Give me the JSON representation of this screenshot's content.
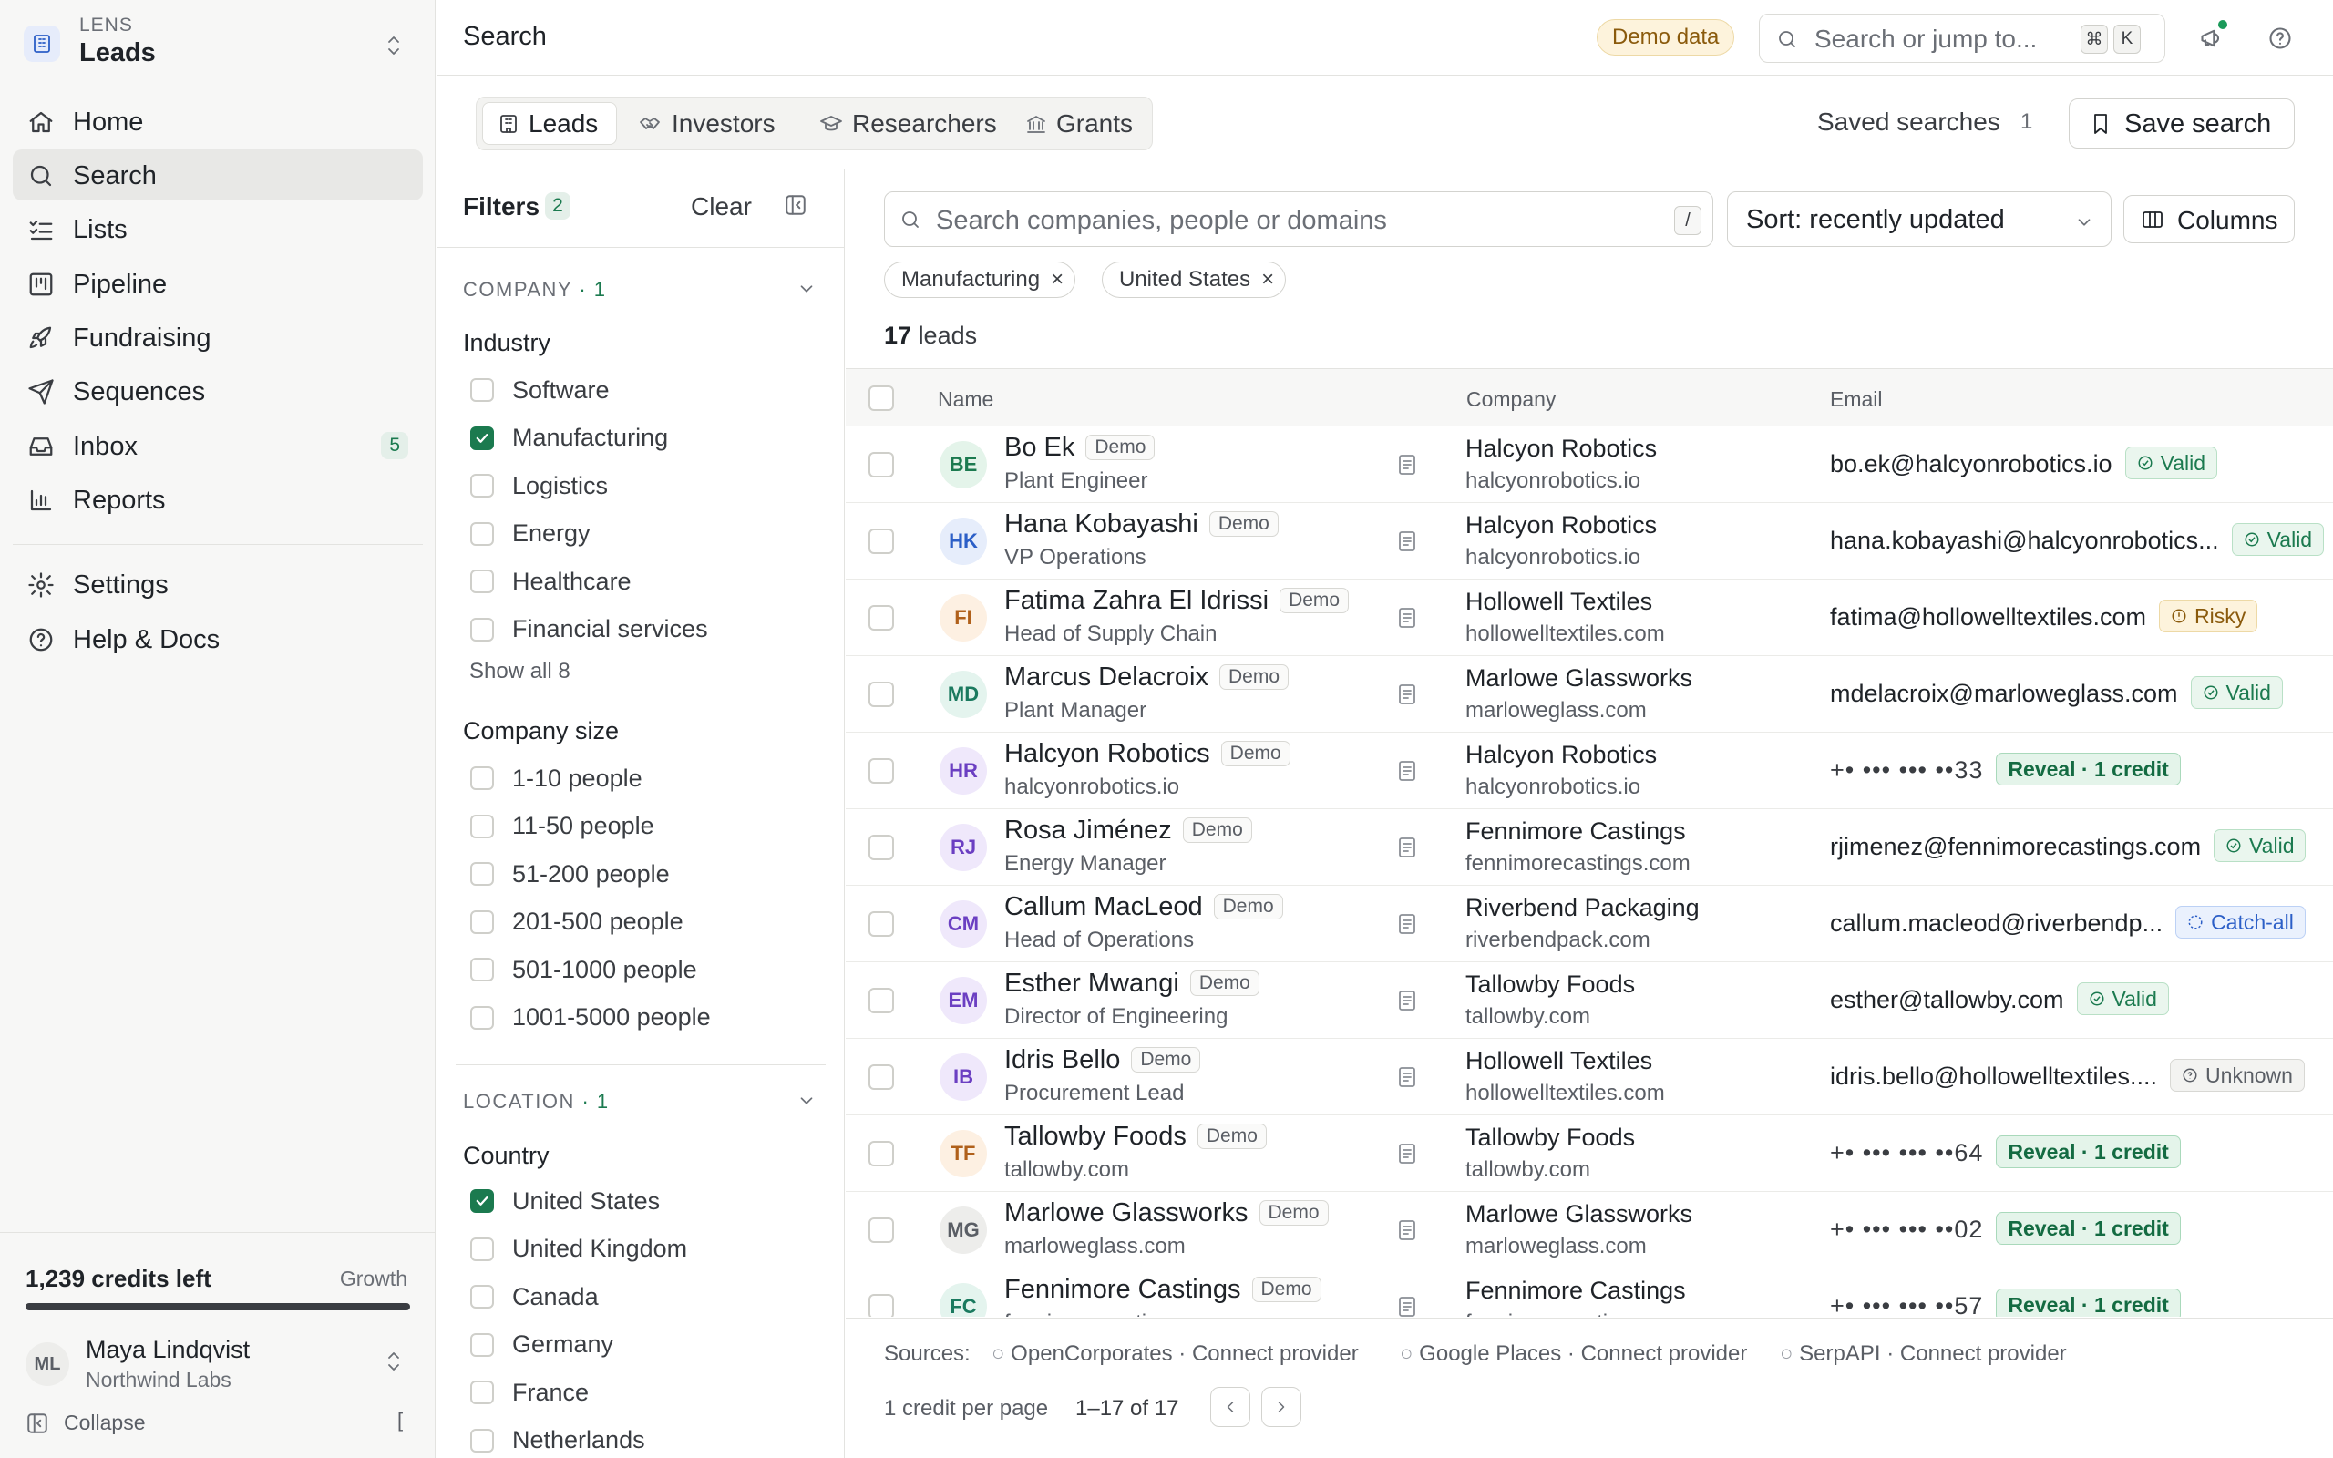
{
  "workspace": {
    "small_label": "LENS",
    "name": "Leads"
  },
  "nav": [
    {
      "label": "Home",
      "icon": "home-icon"
    },
    {
      "label": "Search",
      "icon": "search-icon",
      "active": true
    },
    {
      "label": "Lists",
      "icon": "list-check-icon"
    },
    {
      "label": "Pipeline",
      "icon": "kanban-icon"
    },
    {
      "label": "Fundraising",
      "icon": "rocket-icon"
    },
    {
      "label": "Sequences",
      "icon": "send-icon"
    },
    {
      "label": "Inbox",
      "icon": "inbox-icon",
      "count": "5"
    },
    {
      "label": "Reports",
      "icon": "bar-chart-icon"
    }
  ],
  "nav_secondary": [
    {
      "label": "Settings",
      "icon": "gear-icon"
    },
    {
      "label": "Help & Docs",
      "icon": "help-icon"
    }
  ],
  "credits": {
    "text": "1,239 credits left",
    "plan": "Growth",
    "fraction": 1.0
  },
  "user": {
    "initials": "ML",
    "name": "Maya Lindqvist",
    "org": "Northwind Labs"
  },
  "collapse": {
    "label": "Collapse",
    "shortcut": "["
  },
  "topbar": {
    "title": "Search",
    "demo_badge": "Demo data",
    "search_placeholder": "Search or jump to...",
    "kbd1": "⌘",
    "kbd2": "K"
  },
  "tabs": [
    {
      "label": "Leads",
      "icon": "building-icon",
      "active": true
    },
    {
      "label": "Investors",
      "icon": "handshake-icon"
    },
    {
      "label": "Researchers",
      "icon": "graduation-cap-icon"
    },
    {
      "label": "Grants",
      "icon": "landmark-icon"
    }
  ],
  "saved": {
    "label": "Saved searches",
    "count": "1",
    "save_label": "Save search"
  },
  "filters": {
    "title": "Filters",
    "count": "2",
    "clear": "Clear",
    "company_section": {
      "label": "COMPANY",
      "count": "· 1"
    },
    "industry": {
      "label": "Industry",
      "options": [
        {
          "label": "Software",
          "checked": false
        },
        {
          "label": "Manufacturing",
          "checked": true
        },
        {
          "label": "Logistics",
          "checked": false
        },
        {
          "label": "Energy",
          "checked": false
        },
        {
          "label": "Healthcare",
          "checked": false
        },
        {
          "label": "Financial services",
          "checked": false
        }
      ],
      "show_all": "Show all 8"
    },
    "size": {
      "label": "Company size",
      "options": [
        {
          "label": "1-10 people",
          "checked": false
        },
        {
          "label": "11-50 people",
          "checked": false
        },
        {
          "label": "51-200 people",
          "checked": false
        },
        {
          "label": "201-500 people",
          "checked": false
        },
        {
          "label": "501-1000 people",
          "checked": false
        },
        {
          "label": "1001-5000 people",
          "checked": false
        }
      ]
    },
    "location_section": {
      "label": "LOCATION",
      "count": "· 1"
    },
    "country": {
      "label": "Country",
      "options": [
        {
          "label": "United States",
          "checked": true
        },
        {
          "label": "United Kingdom",
          "checked": false
        },
        {
          "label": "Canada",
          "checked": false
        },
        {
          "label": "Germany",
          "checked": false
        },
        {
          "label": "France",
          "checked": false
        },
        {
          "label": "Netherlands",
          "checked": false
        }
      ]
    }
  },
  "search": {
    "placeholder": "Search companies, people or domains",
    "shortcut": "/"
  },
  "sort": {
    "label": "Sort: recently updated"
  },
  "columns_label": "Columns",
  "chips": [
    {
      "label": "Manufacturing"
    },
    {
      "label": "United States"
    }
  ],
  "results": {
    "count": "17",
    "label": "leads"
  },
  "table": {
    "headers": {
      "name": "Name",
      "company": "Company",
      "email": "Email"
    },
    "demo_tag": "Demo",
    "rows": [
      {
        "initials": "BE",
        "name": "Bo Ek",
        "title": "Plant Engineer",
        "company": "Halcyon Robotics",
        "domain": "halcyonrobotics.io",
        "email": "bo.ek@halcyonrobotics.io",
        "status": "Valid",
        "status_type": "valid",
        "avatar_bg": "#e4f4ea",
        "avatar_fg": "#1b7a4f"
      },
      {
        "initials": "HK",
        "name": "Hana Kobayashi",
        "title": "VP Operations",
        "company": "Halcyon Robotics",
        "domain": "halcyonrobotics.io",
        "email": "hana.kobayashi@halcyonrobotics...",
        "status": "Valid",
        "status_type": "valid",
        "avatar_bg": "#e6edfb",
        "avatar_fg": "#2c5fc7"
      },
      {
        "initials": "FI",
        "name": "Fatima Zahra El Idrissi",
        "title": "Head of Supply Chain",
        "company": "Hollowell Textiles",
        "domain": "hollowelltextiles.com",
        "email": "fatima@hollowelltextiles.com",
        "status": "Risky",
        "status_type": "risky",
        "avatar_bg": "#fdf0e2",
        "avatar_fg": "#b0601a"
      },
      {
        "initials": "MD",
        "name": "Marcus Delacroix",
        "title": "Plant Manager",
        "company": "Marlowe Glassworks",
        "domain": "marloweglass.com",
        "email": "mdelacroix@marloweglass.com",
        "status": "Valid",
        "status_type": "valid",
        "avatar_bg": "#e4f4ee",
        "avatar_fg": "#1b7a5f"
      },
      {
        "initials": "HR",
        "name": "Halcyon Robotics",
        "title": "halcyonrobotics.io",
        "company": "Halcyon Robotics",
        "domain": "halcyonrobotics.io",
        "email": "+• ••• ••• ••33",
        "status": "Reveal · 1 credit",
        "status_type": "reveal",
        "avatar_bg": "#efe8fb",
        "avatar_fg": "#6b3fc2"
      },
      {
        "initials": "RJ",
        "name": "Rosa Jiménez",
        "title": "Energy Manager",
        "company": "Fennimore Castings",
        "domain": "fennimorecastings.com",
        "email": "rjimenez@fennimorecastings.com",
        "status": "Valid",
        "status_type": "valid",
        "avatar_bg": "#efe8fb",
        "avatar_fg": "#6b3fc2"
      },
      {
        "initials": "CM",
        "name": "Callum MacLeod",
        "title": "Head of Operations",
        "company": "Riverbend Packaging",
        "domain": "riverbendpack.com",
        "email": "callum.macleod@riverbendp...",
        "status": "Catch-all",
        "status_type": "catch",
        "avatar_bg": "#efe8fb",
        "avatar_fg": "#6b3fc2"
      },
      {
        "initials": "EM",
        "name": "Esther Mwangi",
        "title": "Director of Engineering",
        "company": "Tallowby Foods",
        "domain": "tallowby.com",
        "email": "esther@tallowby.com",
        "status": "Valid",
        "status_type": "valid",
        "avatar_bg": "#efe8fb",
        "avatar_fg": "#6b3fc2"
      },
      {
        "initials": "IB",
        "name": "Idris Bello",
        "title": "Procurement Lead",
        "company": "Hollowell Textiles",
        "domain": "hollowelltextiles.com",
        "email": "idris.bello@hollowelltextiles....",
        "status": "Unknown",
        "status_type": "unknown",
        "avatar_bg": "#efe8fb",
        "avatar_fg": "#6b3fc2"
      },
      {
        "initials": "TF",
        "name": "Tallowby Foods",
        "title": "tallowby.com",
        "company": "Tallowby Foods",
        "domain": "tallowby.com",
        "email": "+• ••• ••• ••64",
        "status": "Reveal · 1 credit",
        "status_type": "reveal",
        "avatar_bg": "#fdf0e2",
        "avatar_fg": "#b0601a"
      },
      {
        "initials": "MG",
        "name": "Marlowe Glassworks",
        "title": "marloweglass.com",
        "company": "Marlowe Glassworks",
        "domain": "marloweglass.com",
        "email": "+• ••• ••• ••02",
        "status": "Reveal · 1 credit",
        "status_type": "reveal",
        "avatar_bg": "#ededeb",
        "avatar_fg": "#5a5e65"
      },
      {
        "initials": "FC",
        "name": "Fennimore Castings",
        "title": "fennimorecastings.com",
        "company": "Fennimore Castings",
        "domain": "fennimorecastings.com",
        "email": "+• ••• ••• ••57",
        "status": "Reveal · 1 credit",
        "status_type": "reveal",
        "avatar_bg": "#e4f4ee",
        "avatar_fg": "#1b7a5f"
      }
    ]
  },
  "footer": {
    "sources_label": "Sources:",
    "sources": [
      {
        "name": "OpenCorporates",
        "action": "Connect provider"
      },
      {
        "name": "Google Places",
        "action": "Connect provider"
      },
      {
        "name": "SerpAPI",
        "action": "Connect provider"
      }
    ],
    "per_page": "1 credit per page",
    "range": "1–17 of 17"
  },
  "colors": {
    "accent": "#1b7a4f",
    "border": "#e3e3e0",
    "sidebar_bg": "#f7f7f6"
  }
}
